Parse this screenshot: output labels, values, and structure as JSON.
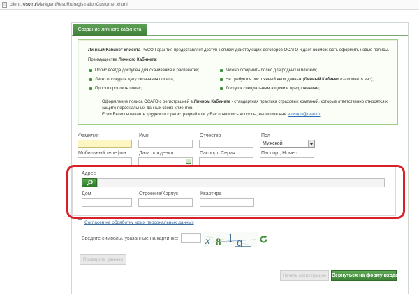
{
  "browser": {
    "url_prefix": "client.",
    "url_domain": "reso.ru",
    "url_path": "/MarkgentResoRu/registrationCustomer.xhtml"
  },
  "tab": {
    "label": "Создание личного кабинета"
  },
  "info": {
    "intro_bold": "Личный Кабинет клиента",
    "intro_text": " РЕСО-Гарантия предоставляет доступ к списку действующих договоров ОСАГО и дает возможность оформить новые полисы.",
    "adv_prefix": "Преимущества ",
    "adv_bold": "Личного Кабинета",
    "adv_suffix": ":",
    "bullets_left": [
      "Полис всегда доступен для скачивания и распечатки;",
      "Легко отследить дату окончания полиса;",
      "Просто продлить полис;"
    ],
    "bullets_right": [
      "Можно оформить полис для родных и близких;",
      "Доступ к специальным акциям и предложениям;"
    ],
    "bullet_r2_pre": "Не требуется постоянный ввод данных (",
    "bullet_r2_bold": "Личный Кабинет",
    "bullet_r2_post": " «запомнит» вас);",
    "reg_pre": "Оформление полиса ОСАГО с регистрацией в ",
    "reg_bold": "Личном Кабинете",
    "reg_post": " - стандартная практика страховых компаний, которые ответственно относятся к",
    "reg_line2": "защите персональных данных своих клиентов.",
    "help_text": "Если Вы испытываете трудности с регистрацией или у Вас появились вопросы, напишите нам ",
    "help_email": "e-osago@reso.ru",
    "help_end": "."
  },
  "form": {
    "lastname_label": "Фамилия",
    "firstname_label": "Имя",
    "patronymic_label": "Отчество",
    "gender_label": "Пол",
    "gender_value": "Мужской",
    "phone_label": "Мобильный телефон",
    "birthdate_label": "Дата рождения",
    "passport_series_label": "Паспорт, Серия",
    "passport_number_label": "Паспорт, Номер"
  },
  "address": {
    "label": "Адрес",
    "house_label": "Дом",
    "building_label": "Строение/Корпус",
    "apartment_label": "Квартира"
  },
  "consent": {
    "label": "Согласен на обработку моих персональных данных"
  },
  "captcha": {
    "label": "Введите символы, указанные на картинке:",
    "chars": [
      "x",
      "8",
      "l",
      "g"
    ]
  },
  "buttons": {
    "check_data": "Проверить данные",
    "register": "Начать регистрацию",
    "back": "Вернуться на форму входа"
  },
  "colors": {
    "brand_green": "#3f7f38",
    "highlight_red": "#d8202a",
    "link_blue": "#2a6ebb"
  }
}
